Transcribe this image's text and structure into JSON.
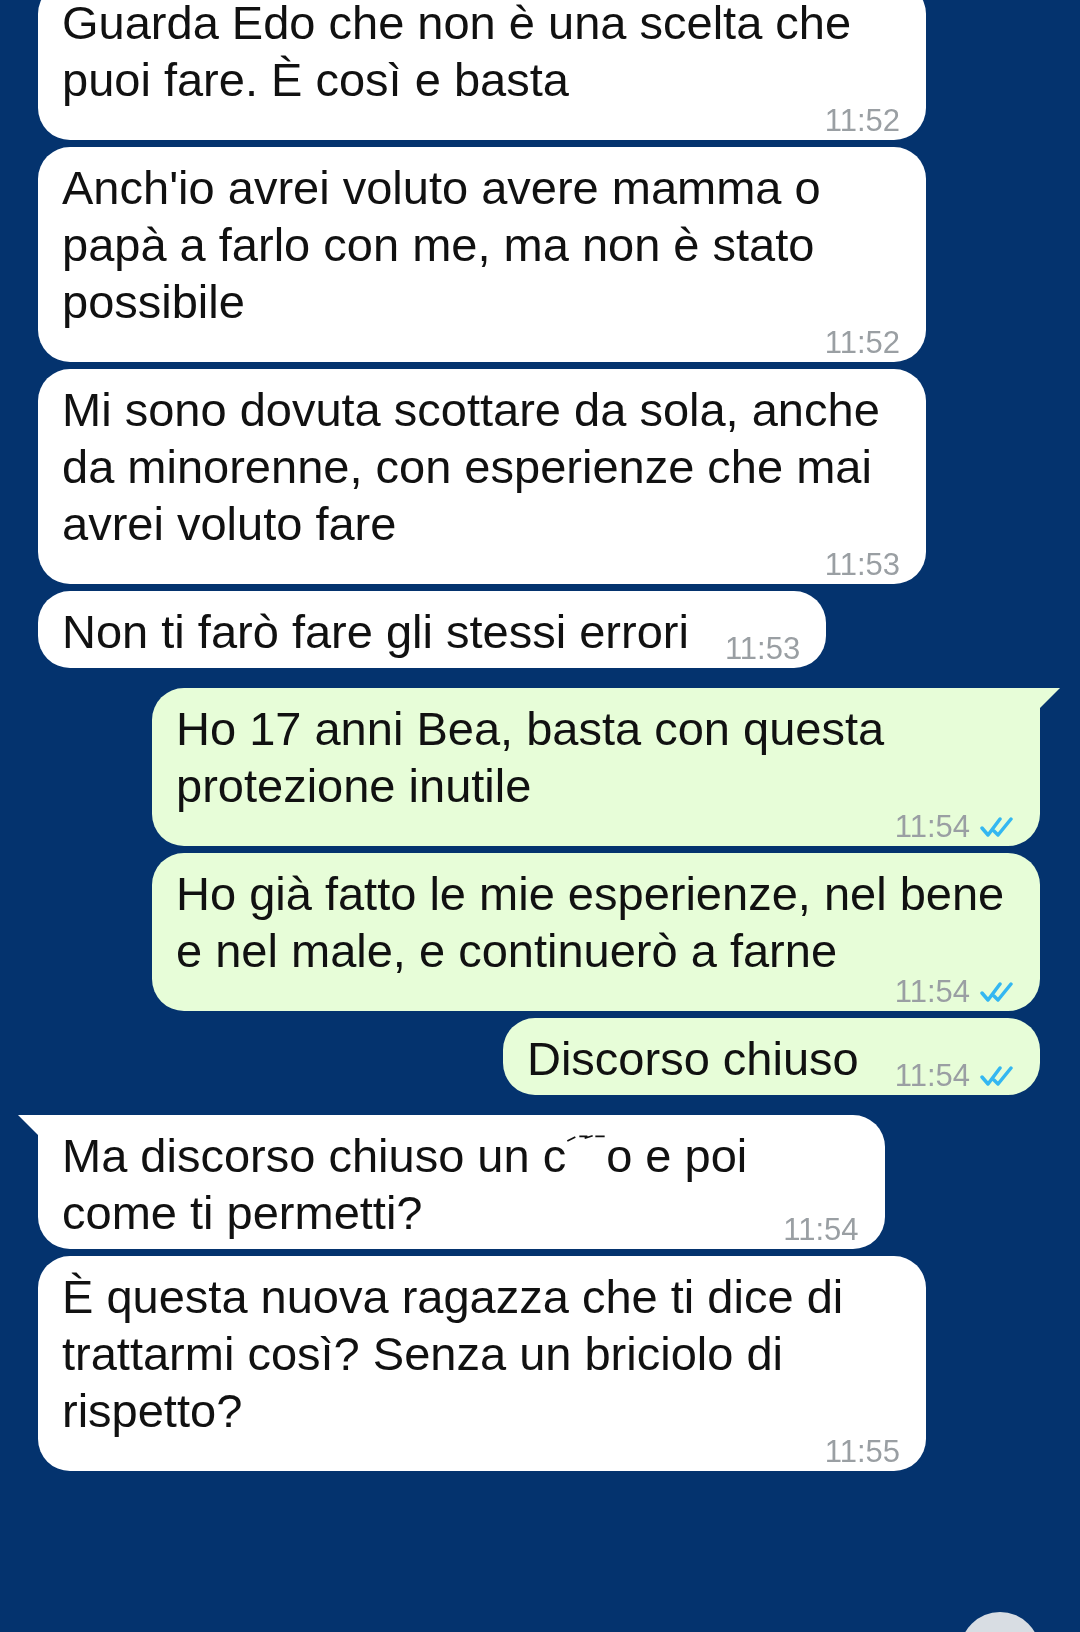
{
  "messages": [
    {
      "kind": "in",
      "tail": false,
      "text_parts": [
        "Guarda Edo che non è una scelta che puoi fare. È così e basta"
      ],
      "time": "11:52"
    },
    {
      "kind": "in",
      "tail": false,
      "text_parts": [
        "Anch'io avrei voluto avere mamma o papà a farlo con me, ma non è stato possibile"
      ],
      "time": "11:52"
    },
    {
      "kind": "in",
      "tail": false,
      "text_parts": [
        "Mi sono dovuta scottare da sola, anche da minorenne, con esperienze che mai avrei voluto fare"
      ],
      "time": "11:53"
    },
    {
      "kind": "in",
      "tail": false,
      "text_parts": [
        "Non ti farò fare gli stessi errori"
      ],
      "time": "11:53"
    },
    {
      "kind": "out",
      "tail": true,
      "text_parts": [
        "Ho 17 anni Bea, basta con questa protezione inutile"
      ],
      "time": "11:54",
      "read": true
    },
    {
      "kind": "out",
      "tail": false,
      "text_parts": [
        "Ho già fatto le mie esperienze, nel bene e nel male, e continuerò a farne"
      ],
      "time": "11:54",
      "read": true
    },
    {
      "kind": "out",
      "tail": false,
      "text_parts": [
        "Discorso chiuso"
      ],
      "time": "11:54",
      "read": true
    },
    {
      "kind": "in",
      "tail": true,
      "text_parts": [
        "Ma discorso chiuso un c",
        "o e poi"
      ],
      "second_line": "come ti permetti?",
      "time": "11:54"
    },
    {
      "kind": "in",
      "tail": false,
      "text_parts": [
        "È questa nuova ragazza che ti dice di trattarmi così? Senza un briciolo di rispetto?"
      ],
      "time": "11:55"
    }
  ]
}
